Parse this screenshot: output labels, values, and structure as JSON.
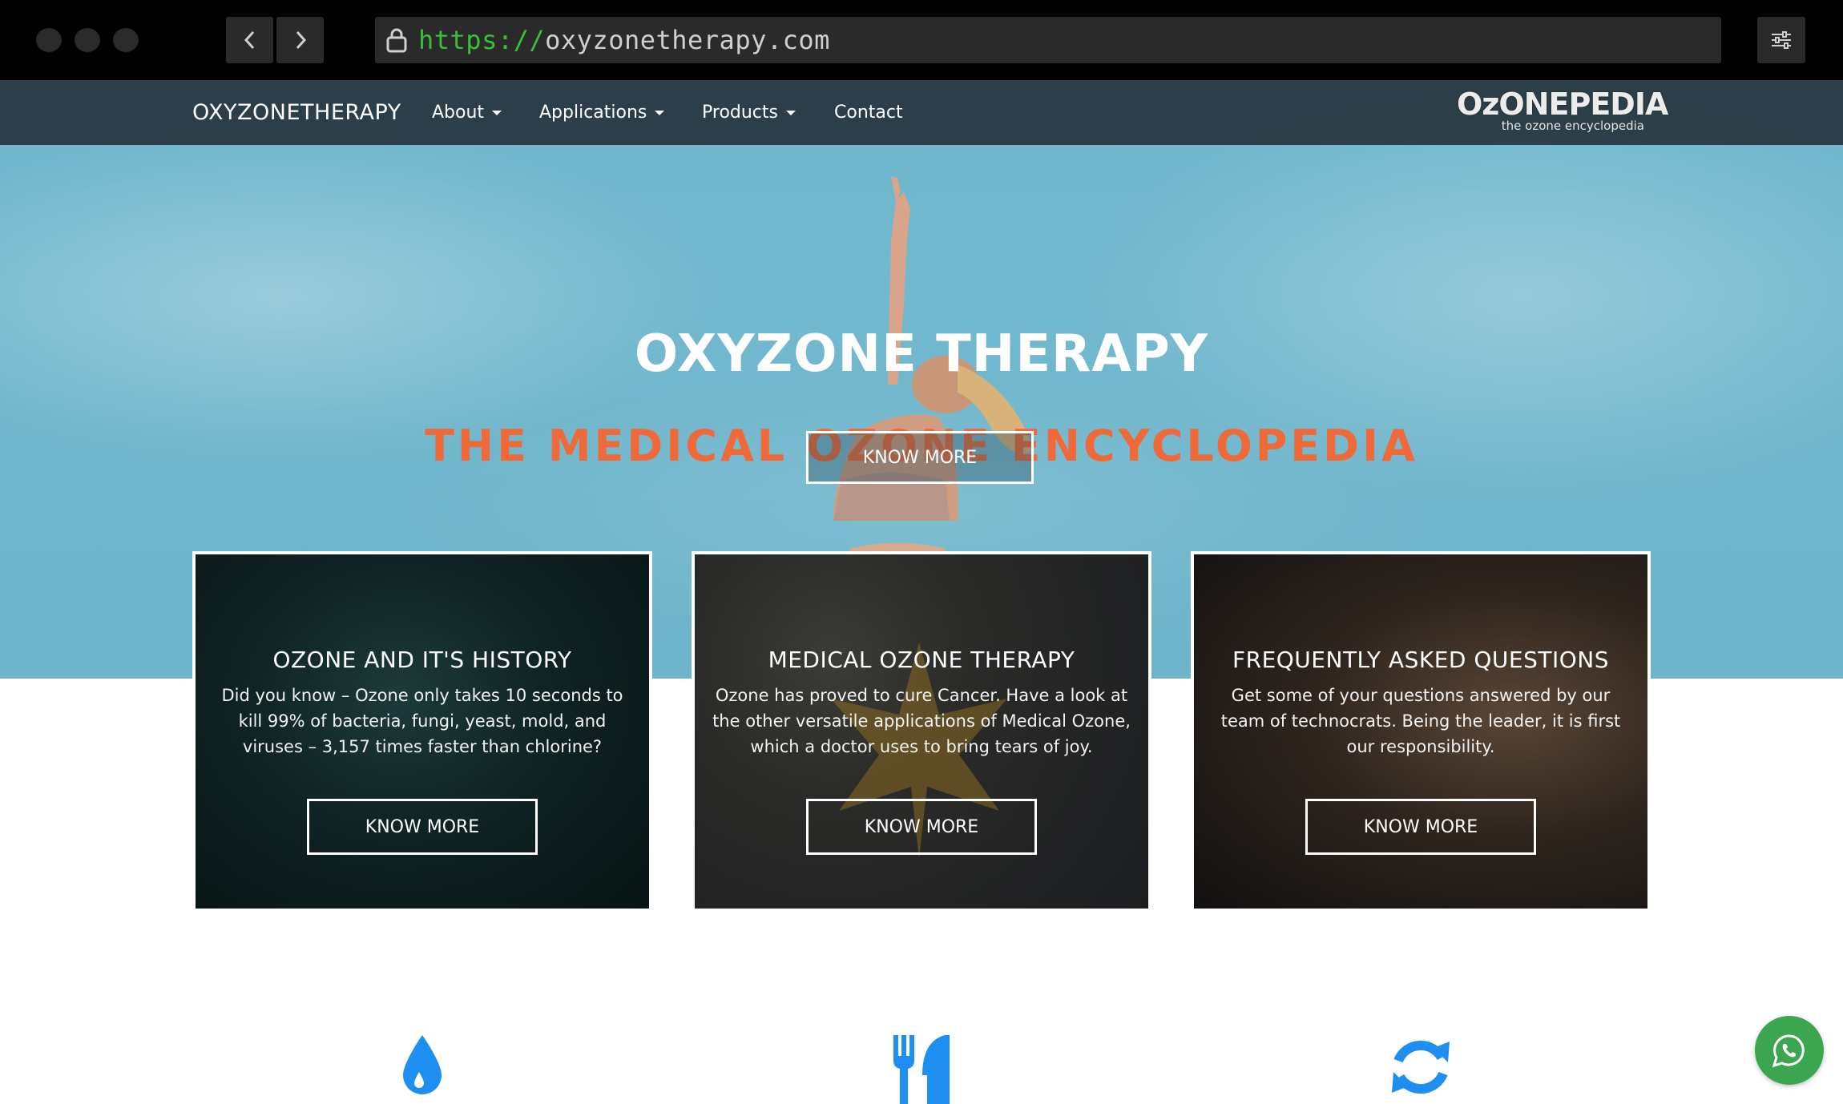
{
  "browser": {
    "url_scheme": "https://",
    "url_host": "oxyzonetherapy.com"
  },
  "nav": {
    "brand": "OXYZONETHERAPY",
    "items": [
      {
        "label": "About",
        "dropdown": true
      },
      {
        "label": "Applications",
        "dropdown": true
      },
      {
        "label": "Products",
        "dropdown": true
      },
      {
        "label": "Contact",
        "dropdown": false
      }
    ],
    "logo_text": "OzONEPEDIA",
    "logo_tagline": "the ozone encyclopedia"
  },
  "hero": {
    "title": "OXYZONE THERAPY",
    "subtitle": "THE MEDICAL OZONE ENCYCLOPEDIA",
    "button": "KNOW MORE",
    "subtitle_color": "#ef6a38"
  },
  "cards": [
    {
      "title": "OZONE AND IT'S HISTORY",
      "text": "Did you know – Ozone only takes 10 seconds to kill 99% of bacteria, fungi, yeast, mold, and viruses – 3,157 times faster than chlorine?",
      "button": "KNOW MORE"
    },
    {
      "title": "MEDICAL OZONE THERAPY",
      "text": "Ozone has proved to cure Cancer. Have a look at the other versatile applications of Medical Ozone, which a doctor uses to bring tears of joy.",
      "button": "KNOW MORE"
    },
    {
      "title": "FREQUENTLY ASKED QUESTIONS",
      "text": "Get some of your questions answered by our team of technocrats. Being the leader, it is first our responsibility.",
      "button": "KNOW MORE"
    }
  ],
  "features": [
    {
      "icon": "water-drop-icon"
    },
    {
      "icon": "utensils-icon"
    },
    {
      "icon": "refresh-icon"
    }
  ],
  "colors": {
    "accent_blue": "#1e8ef0",
    "whatsapp_green": "#3ba550"
  }
}
